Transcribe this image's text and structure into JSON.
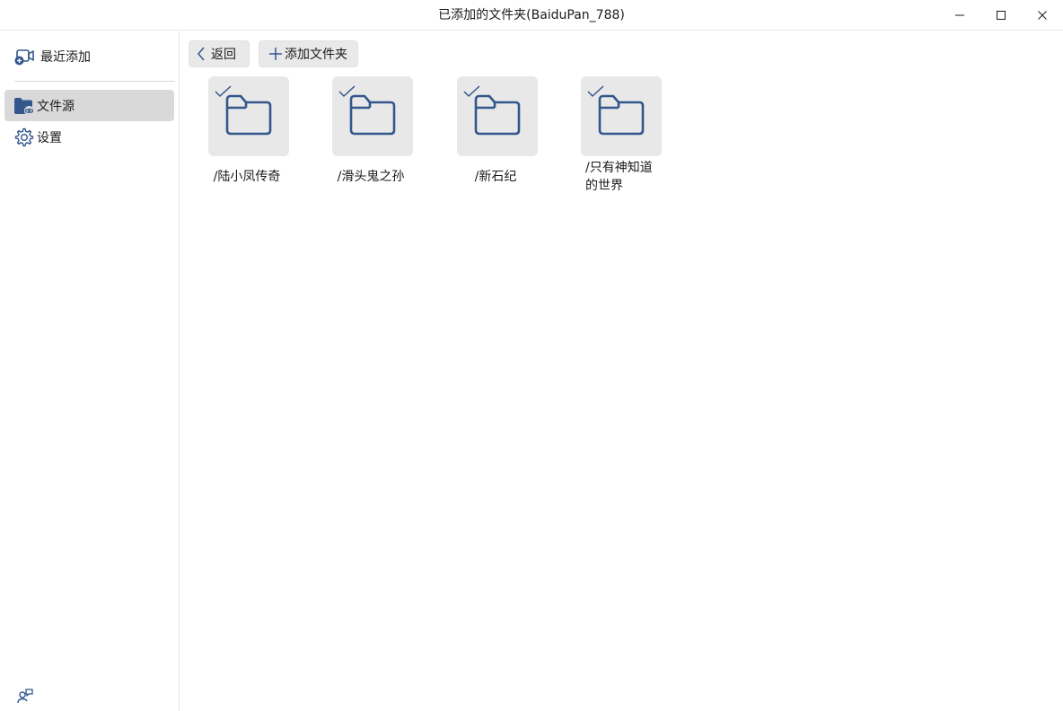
{
  "window": {
    "title": "已添加的文件夹(BaiduPan_788)"
  },
  "sidebar": {
    "items": [
      {
        "label": "最近添加",
        "icon": "video-add-icon"
      },
      {
        "label": "文件源",
        "icon": "folder-link-icon",
        "active": true
      },
      {
        "label": "设置",
        "icon": "gear-icon"
      }
    ],
    "footer_icon": "feedback-icon"
  },
  "toolbar": {
    "back_label": "返回",
    "add_folder_label": "添加文件夹"
  },
  "folders": [
    {
      "name": "/陆小凤传奇",
      "checked": true
    },
    {
      "name": "/滑头鬼之孙",
      "checked": true
    },
    {
      "name": "/新石纪",
      "checked": true
    },
    {
      "name": "/只有神知道的世界",
      "checked": true
    }
  ],
  "colors": {
    "accent": "#33578c",
    "active_bg": "#d9d9d9",
    "tile_bg": "#e8e8e8"
  }
}
